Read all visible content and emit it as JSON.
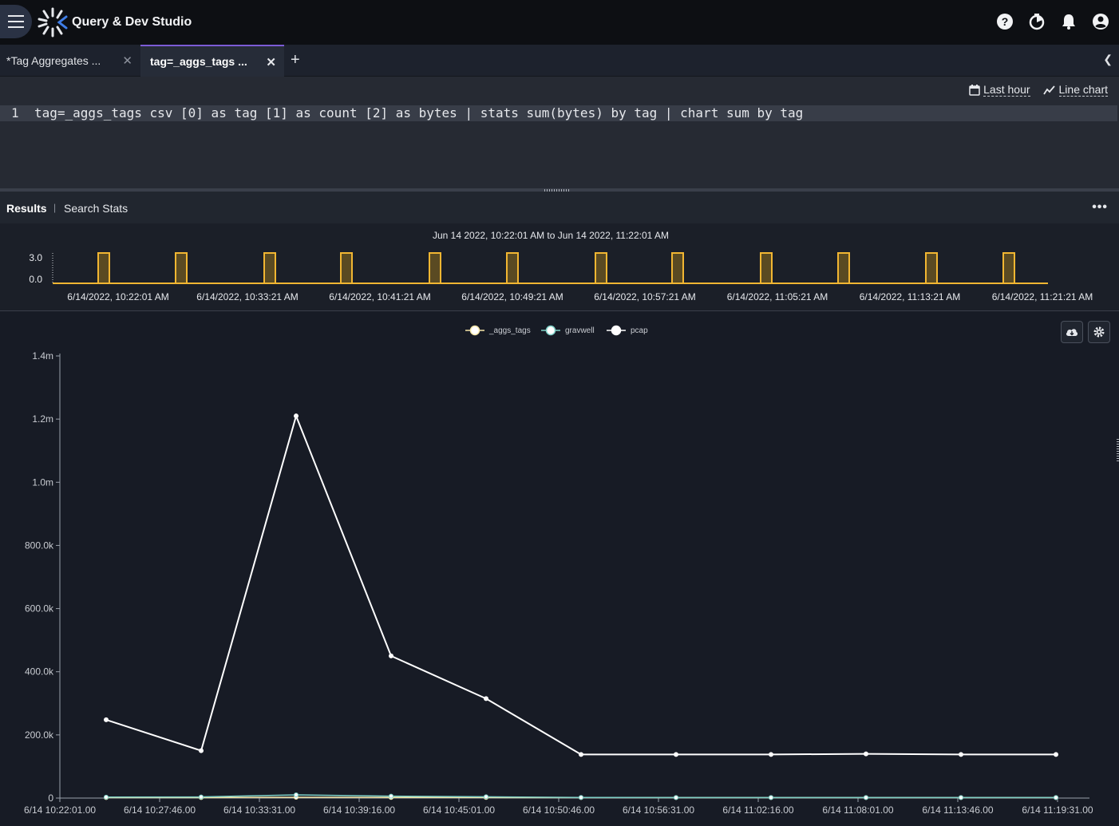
{
  "app": {
    "title": "Query & Dev Studio"
  },
  "header": {
    "icons": [
      "help-icon",
      "timer-icon",
      "bell-icon",
      "account-icon"
    ]
  },
  "tabs": [
    {
      "label": "*Tag Aggregates ...",
      "active": false
    },
    {
      "label": "tag=_aggs_tags ...",
      "active": true
    }
  ],
  "editor": {
    "time_range_label": "Last hour",
    "renderer_label": "Line chart",
    "line_number": "1",
    "query": "tag=_aggs_tags csv [0] as tag [1] as count [2] as bytes | stats sum(bytes) by tag | chart sum by tag"
  },
  "results": {
    "results_tab": "Results",
    "stats_tab": "Search Stats"
  },
  "timeline": {
    "range_text": "Jun 14 2022, 10:22:01 AM to Jun 14 2022, 11:22:01 AM",
    "y_ticks": [
      "3.0",
      "0.0"
    ],
    "x_labels": [
      "6/14/2022, 10:22:01 AM",
      "6/14/2022, 10:33:21 AM",
      "6/14/2022, 10:41:21 AM",
      "6/14/2022, 10:49:21 AM",
      "6/14/2022, 10:57:21 AM",
      "6/14/2022, 11:05:21 AM",
      "6/14/2022, 11:13:21 AM",
      "6/14/2022, 11:21:21 AM"
    ],
    "bar_count": 12,
    "bar_color": "#f2b632"
  },
  "chart_data": {
    "type": "line",
    "x": [
      "6/14 10:22:01.00",
      "6/14 10:27:46.00",
      "6/14 10:33:31.00",
      "6/14 10:39:16.00",
      "6/14 10:45:01.00",
      "6/14 10:50:46.00",
      "6/14 10:56:31.00",
      "6/14 11:02:16.00",
      "6/14 11:08:01.00",
      "6/14 11:13:46.00",
      "6/14 11:19:31.00"
    ],
    "series": [
      {
        "name": "_aggs_tags",
        "color": "#f5e6a8",
        "values": [
          1500,
          1500,
          2500,
          2000,
          1800,
          1500,
          1500,
          1500,
          1500,
          1500,
          1500
        ]
      },
      {
        "name": "gravwell",
        "color": "#7fd1c8",
        "values": [
          3000,
          3500,
          10000,
          6000,
          4000,
          2000,
          1500,
          1500,
          1500,
          1500,
          1500
        ]
      },
      {
        "name": "pcap",
        "color": "#ffffff",
        "values": [
          248000,
          150000,
          1210000,
          450000,
          315000,
          138000,
          138000,
          138000,
          140000,
          138000,
          138000
        ]
      }
    ],
    "y_ticks": [
      "0",
      "200.0k",
      "400.0k",
      "600.0k",
      "800.0k",
      "1.0m",
      "1.2m",
      "1.4m"
    ],
    "ylim": [
      0,
      1400000
    ],
    "legend_position": "top-center",
    "grid": false
  }
}
